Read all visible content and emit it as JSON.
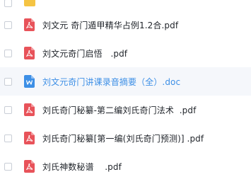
{
  "files": [
    {
      "name": "",
      "type": "folder"
    },
    {
      "name": "刘文元 奇门遁甲精华占例1.2合.pdf",
      "type": "pdf"
    },
    {
      "name": "刘文元奇门启悟   .pdf",
      "type": "pdf"
    },
    {
      "name": "刘文元奇门讲课录音摘要（全）.doc",
      "type": "doc"
    },
    {
      "name": "刘氏奇门秘纂-第二编刘氏奇门法术  .pdf",
      "type": "pdf"
    },
    {
      "name": "刘氏奇门秘纂[第一编(刘氏奇门预测)] .pdf",
      "type": "pdf"
    },
    {
      "name": "刘氏神数秘谱    .pdf",
      "type": "pdf"
    }
  ],
  "colors": {
    "pdf_icon": "#e8535a",
    "doc_icon": "#3d8fe6",
    "folder_icon": "#f5c443",
    "active_text": "#3d8fe6"
  },
  "icons": {
    "pdf": "pdf-file-icon",
    "doc": "word-doc-file-icon",
    "folder": "folder-icon"
  }
}
